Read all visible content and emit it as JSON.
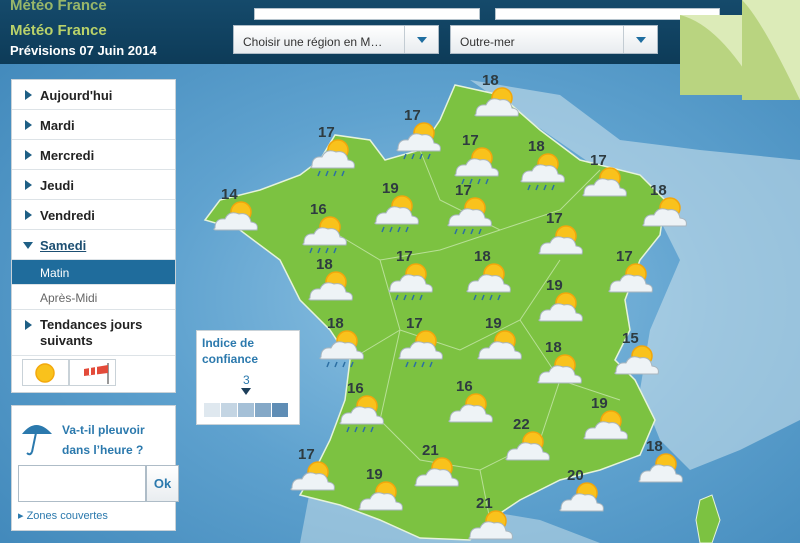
{
  "header": {
    "ghost_title": "Météo France",
    "title": "Météo France",
    "date": "Prévisions 07 Juin 2014"
  },
  "selects": {
    "region": "Choisir une région en M…",
    "outremer": "Outre-mer"
  },
  "nav": {
    "items": [
      {
        "label": "Aujourd'hui"
      },
      {
        "label": "Mardi"
      },
      {
        "label": "Mercredi"
      },
      {
        "label": "Jeudi"
      },
      {
        "label": "Vendredi"
      },
      {
        "label": "Samedi",
        "open": true
      }
    ],
    "sub": [
      "Matin",
      "Après-Midi"
    ],
    "trends": "Tendances jours suivants"
  },
  "rain": {
    "question": "Va-t-il pleuvoir dans l’heure ?",
    "ok": "Ok",
    "zones": "Zones couvertes"
  },
  "confidence": {
    "title": "Indice de confiance",
    "value": "3",
    "colors": [
      "#dfe8ef",
      "#c4d5e3",
      "#a5c0d7",
      "#84a8c7",
      "#5f8db5"
    ]
  },
  "temperatures": [
    "18",
    "17",
    "17",
    "17",
    "18",
    "17",
    "18",
    "14",
    "16",
    "19",
    "17",
    "17",
    "17",
    "18",
    "17",
    "18",
    "19",
    "18",
    "17",
    "19",
    "15",
    "18",
    "16",
    "16",
    "19",
    "22",
    "18",
    "17",
    "19",
    "21",
    "20",
    "21"
  ],
  "colors": {
    "land": "#7cc241",
    "sea": "#5fa2cf",
    "header": "#0f4d72",
    "accent": "#1f6c9c"
  },
  "icons": {
    "weather": "sun-cloud-icon",
    "rain": "sun-cloud-rain-icon",
    "sun": "sun-icon",
    "wind": "windsock-icon",
    "umbrella": "umbrella-icon"
  }
}
